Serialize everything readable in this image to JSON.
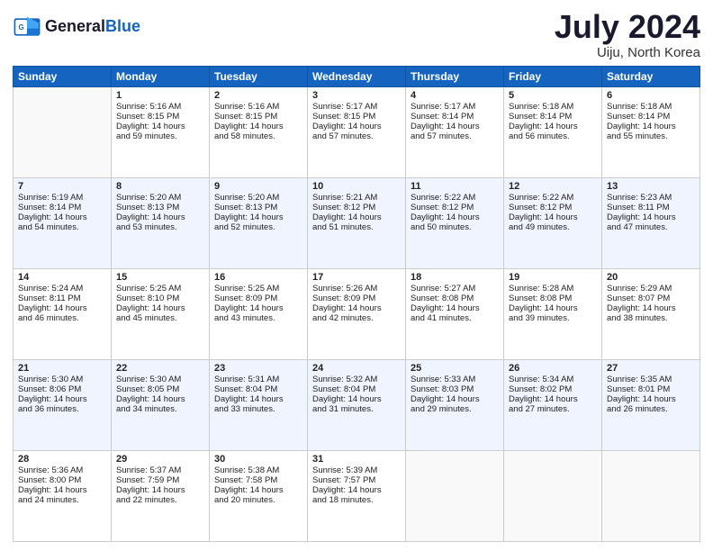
{
  "header": {
    "logo_line1": "General",
    "logo_line2": "Blue",
    "title": "July 2024",
    "subtitle": "Uiju, North Korea"
  },
  "days_of_week": [
    "Sunday",
    "Monday",
    "Tuesday",
    "Wednesday",
    "Thursday",
    "Friday",
    "Saturday"
  ],
  "weeks": [
    [
      {
        "day": "",
        "info": ""
      },
      {
        "day": "1",
        "info": "Sunrise: 5:16 AM\nSunset: 8:15 PM\nDaylight: 14 hours\nand 59 minutes."
      },
      {
        "day": "2",
        "info": "Sunrise: 5:16 AM\nSunset: 8:15 PM\nDaylight: 14 hours\nand 58 minutes."
      },
      {
        "day": "3",
        "info": "Sunrise: 5:17 AM\nSunset: 8:15 PM\nDaylight: 14 hours\nand 57 minutes."
      },
      {
        "day": "4",
        "info": "Sunrise: 5:17 AM\nSunset: 8:14 PM\nDaylight: 14 hours\nand 57 minutes."
      },
      {
        "day": "5",
        "info": "Sunrise: 5:18 AM\nSunset: 8:14 PM\nDaylight: 14 hours\nand 56 minutes."
      },
      {
        "day": "6",
        "info": "Sunrise: 5:18 AM\nSunset: 8:14 PM\nDaylight: 14 hours\nand 55 minutes."
      }
    ],
    [
      {
        "day": "7",
        "info": "Sunrise: 5:19 AM\nSunset: 8:14 PM\nDaylight: 14 hours\nand 54 minutes."
      },
      {
        "day": "8",
        "info": "Sunrise: 5:20 AM\nSunset: 8:13 PM\nDaylight: 14 hours\nand 53 minutes."
      },
      {
        "day": "9",
        "info": "Sunrise: 5:20 AM\nSunset: 8:13 PM\nDaylight: 14 hours\nand 52 minutes."
      },
      {
        "day": "10",
        "info": "Sunrise: 5:21 AM\nSunset: 8:12 PM\nDaylight: 14 hours\nand 51 minutes."
      },
      {
        "day": "11",
        "info": "Sunrise: 5:22 AM\nSunset: 8:12 PM\nDaylight: 14 hours\nand 50 minutes."
      },
      {
        "day": "12",
        "info": "Sunrise: 5:22 AM\nSunset: 8:12 PM\nDaylight: 14 hours\nand 49 minutes."
      },
      {
        "day": "13",
        "info": "Sunrise: 5:23 AM\nSunset: 8:11 PM\nDaylight: 14 hours\nand 47 minutes."
      }
    ],
    [
      {
        "day": "14",
        "info": "Sunrise: 5:24 AM\nSunset: 8:11 PM\nDaylight: 14 hours\nand 46 minutes."
      },
      {
        "day": "15",
        "info": "Sunrise: 5:25 AM\nSunset: 8:10 PM\nDaylight: 14 hours\nand 45 minutes."
      },
      {
        "day": "16",
        "info": "Sunrise: 5:25 AM\nSunset: 8:09 PM\nDaylight: 14 hours\nand 43 minutes."
      },
      {
        "day": "17",
        "info": "Sunrise: 5:26 AM\nSunset: 8:09 PM\nDaylight: 14 hours\nand 42 minutes."
      },
      {
        "day": "18",
        "info": "Sunrise: 5:27 AM\nSunset: 8:08 PM\nDaylight: 14 hours\nand 41 minutes."
      },
      {
        "day": "19",
        "info": "Sunrise: 5:28 AM\nSunset: 8:08 PM\nDaylight: 14 hours\nand 39 minutes."
      },
      {
        "day": "20",
        "info": "Sunrise: 5:29 AM\nSunset: 8:07 PM\nDaylight: 14 hours\nand 38 minutes."
      }
    ],
    [
      {
        "day": "21",
        "info": "Sunrise: 5:30 AM\nSunset: 8:06 PM\nDaylight: 14 hours\nand 36 minutes."
      },
      {
        "day": "22",
        "info": "Sunrise: 5:30 AM\nSunset: 8:05 PM\nDaylight: 14 hours\nand 34 minutes."
      },
      {
        "day": "23",
        "info": "Sunrise: 5:31 AM\nSunset: 8:04 PM\nDaylight: 14 hours\nand 33 minutes."
      },
      {
        "day": "24",
        "info": "Sunrise: 5:32 AM\nSunset: 8:04 PM\nDaylight: 14 hours\nand 31 minutes."
      },
      {
        "day": "25",
        "info": "Sunrise: 5:33 AM\nSunset: 8:03 PM\nDaylight: 14 hours\nand 29 minutes."
      },
      {
        "day": "26",
        "info": "Sunrise: 5:34 AM\nSunset: 8:02 PM\nDaylight: 14 hours\nand 27 minutes."
      },
      {
        "day": "27",
        "info": "Sunrise: 5:35 AM\nSunset: 8:01 PM\nDaylight: 14 hours\nand 26 minutes."
      }
    ],
    [
      {
        "day": "28",
        "info": "Sunrise: 5:36 AM\nSunset: 8:00 PM\nDaylight: 14 hours\nand 24 minutes."
      },
      {
        "day": "29",
        "info": "Sunrise: 5:37 AM\nSunset: 7:59 PM\nDaylight: 14 hours\nand 22 minutes."
      },
      {
        "day": "30",
        "info": "Sunrise: 5:38 AM\nSunset: 7:58 PM\nDaylight: 14 hours\nand 20 minutes."
      },
      {
        "day": "31",
        "info": "Sunrise: 5:39 AM\nSunset: 7:57 PM\nDaylight: 14 hours\nand 18 minutes."
      },
      {
        "day": "",
        "info": ""
      },
      {
        "day": "",
        "info": ""
      },
      {
        "day": "",
        "info": ""
      }
    ]
  ]
}
